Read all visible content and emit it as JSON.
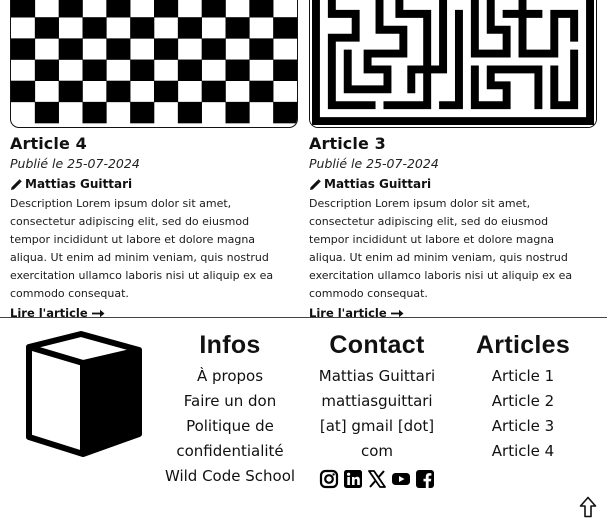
{
  "articles": [
    {
      "title": "Article 4",
      "date": "Publié le 25-07-2024",
      "author": "Mattias Guittari",
      "description": "Description Lorem ipsum dolor sit amet, consectetur adipiscing elit, sed do eiusmod tempor incididunt ut labore et dolore magna aliqua. Ut enim ad minim veniam, quis nostrud exercitation ullamco laboris nisi ut aliquip ex ea commodo consequat.",
      "link_label": "Lire l'article",
      "image_icon": "checkerboard-pattern"
    },
    {
      "title": "Article 3",
      "date": "Publié le 25-07-2024",
      "author": "Mattias Guittari",
      "description": "Description Lorem ipsum dolor sit amet, consectetur adipiscing elit, sed do eiusmod tempor incididunt ut labore et dolore magna aliqua. Ut enim ad minim veniam, quis nostrud exercitation ullamco laboris nisi ut aliquip ex ea commodo consequat.",
      "link_label": "Lire l'article",
      "image_icon": "maze-pattern"
    }
  ],
  "footer": {
    "logo_icon": "cube-icon",
    "infos": {
      "heading": "Infos",
      "links": [
        "À propos",
        "Faire un don",
        "Politique de",
        "confidentialité",
        "Wild Code School"
      ]
    },
    "contact": {
      "heading": "Contact",
      "lines": [
        "Mattias Guittari",
        "mattiasguittari",
        "[at] gmail [dot]",
        "com"
      ],
      "socials": [
        "instagram-icon",
        "linkedin-icon",
        "x-icon",
        "youtube-icon",
        "facebook-icon"
      ]
    },
    "articles": {
      "heading": "Articles",
      "links": [
        "Article 1",
        "Article 2",
        "Article 3",
        "Article 4"
      ]
    },
    "back_to_top_icon": "arrow-up-icon"
  },
  "colors": {
    "text": "#111111",
    "background": "#ffffff",
    "divider": "#444444"
  }
}
